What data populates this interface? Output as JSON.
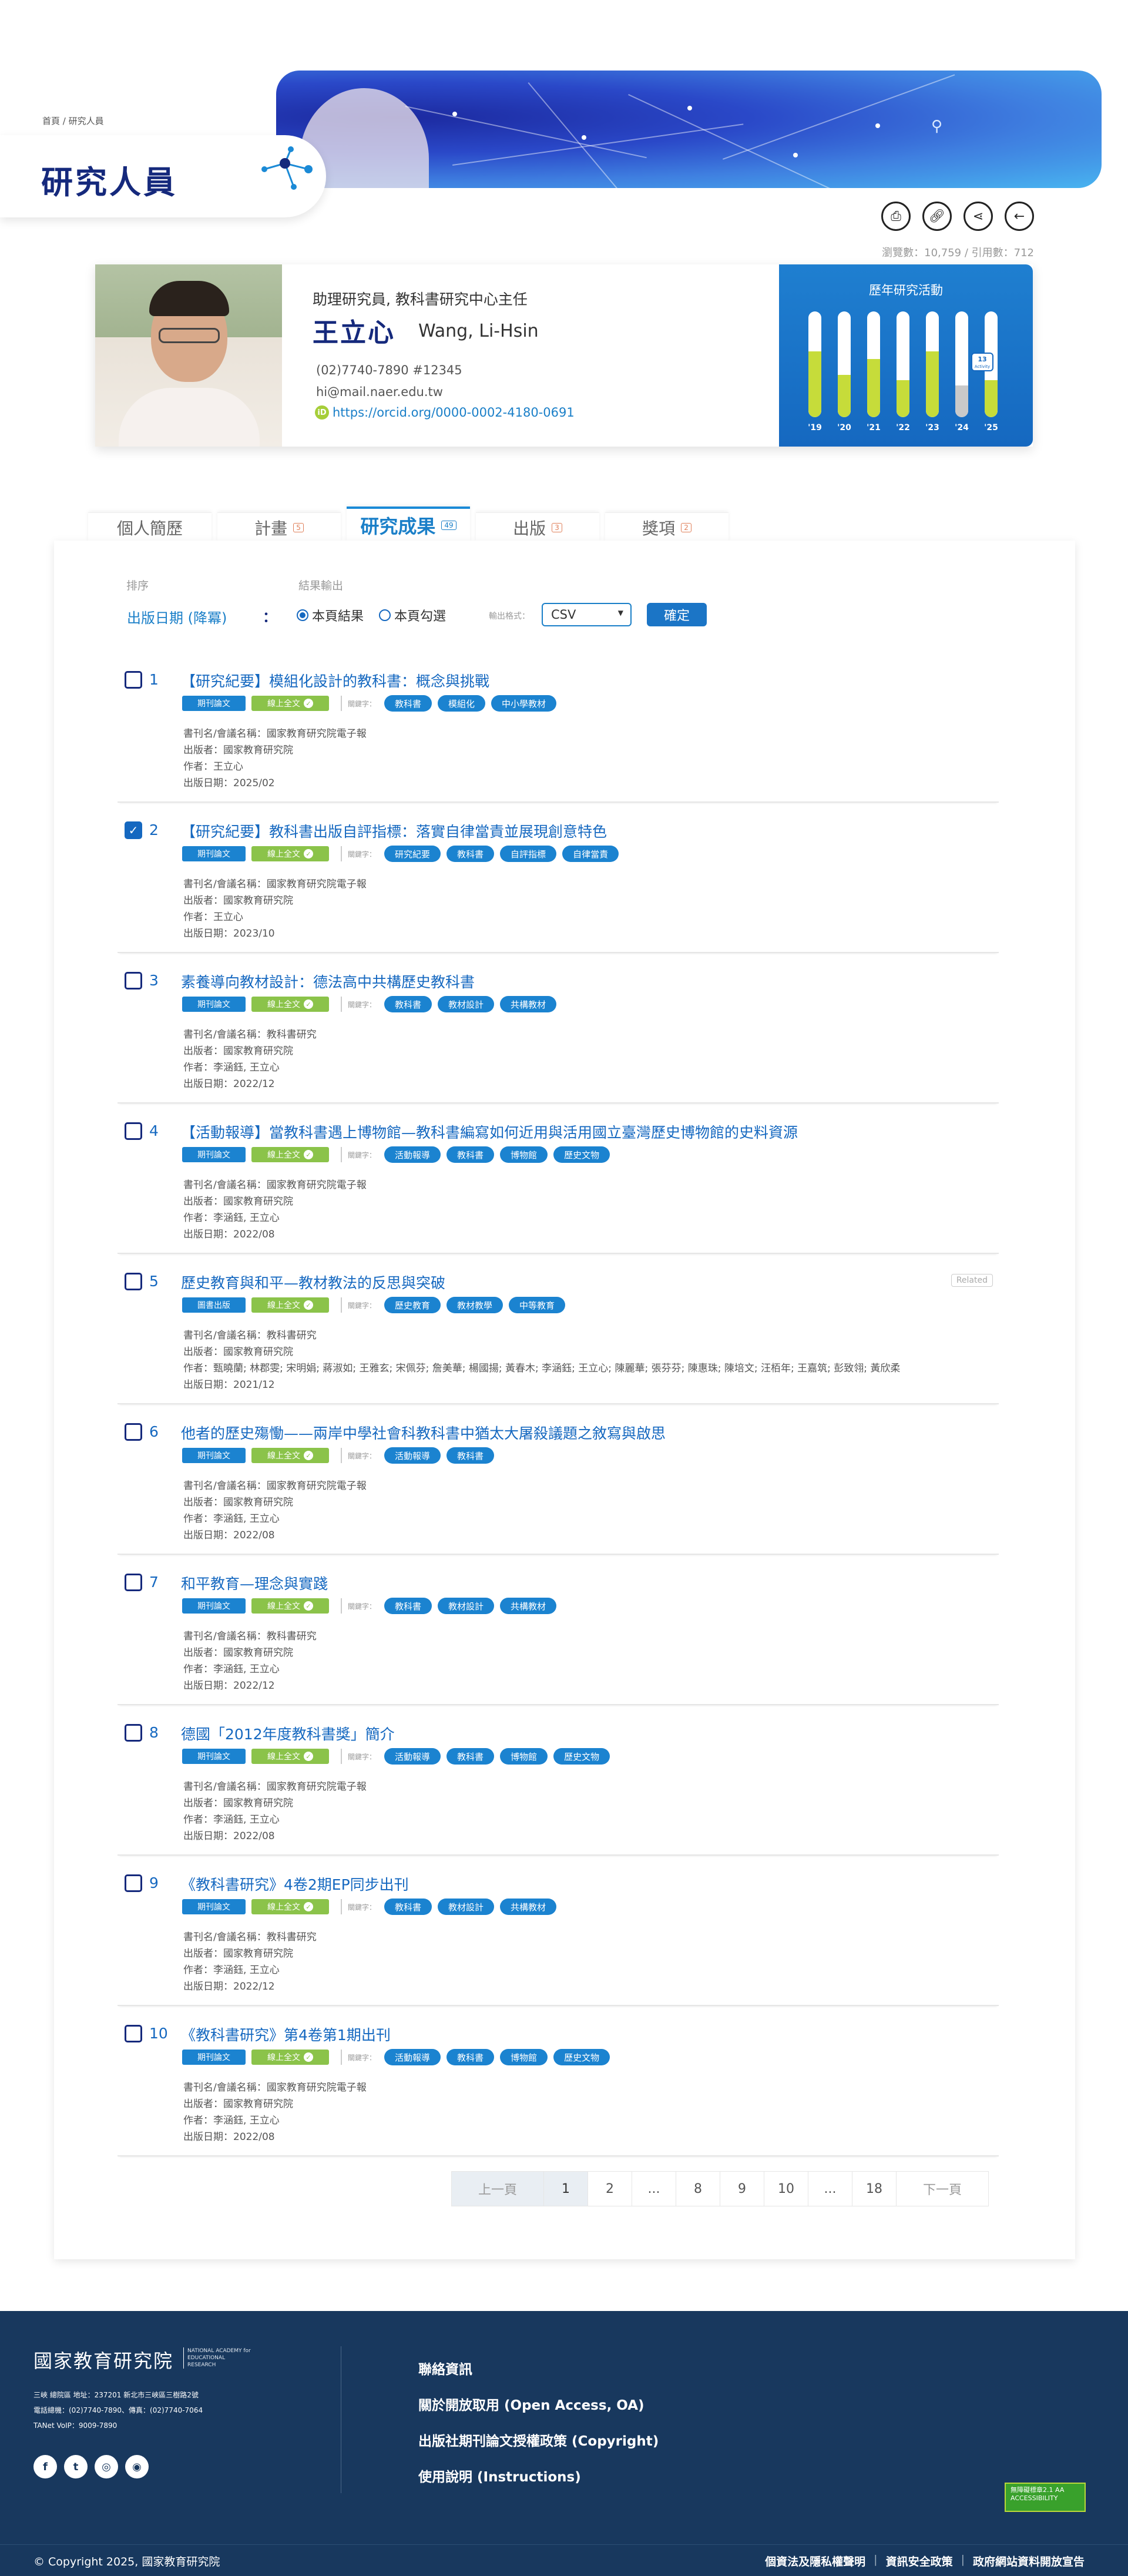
{
  "breadcrumb": "首頁 / 研究人員",
  "page_title": "研究人員",
  "tools": {
    "print_icon": "printer-icon",
    "link_icon": "link-icon",
    "share_icon": "share-icon",
    "back_icon": "back-arrow-icon"
  },
  "stats": "瀏覽數：10,759 / 引用數：712",
  "profile": {
    "job_title": "助理研究員, 教科書研究中心主任",
    "name_zh": "王立心",
    "name_en": "Wang, Li-Hsin",
    "phone": "(02)7740-7890 #12345",
    "email": "hi@mail.naer.edu.tw",
    "orcid_badge": "iD",
    "orcid": "https://orcid.org/0000-0002-4180-0691"
  },
  "activity": {
    "title": "歷年研究活動",
    "years": [
      "'19",
      "'20",
      "'21",
      "'22",
      "'23",
      "'24",
      "'25"
    ],
    "levels": [
      0.62,
      0.4,
      0.55,
      0.35,
      0.62,
      0.3,
      0.35
    ],
    "highlight_index": 5,
    "tooltip_value": "13",
    "tooltip_unit": "Activity"
  },
  "tabs": [
    {
      "label": "個人簡歷",
      "count": ""
    },
    {
      "label": "計畫",
      "count": "5"
    },
    {
      "label": "研究成果",
      "count": "49"
    },
    {
      "label": "出版",
      "count": "3"
    },
    {
      "label": "獎項",
      "count": "2"
    }
  ],
  "filter": {
    "sort_label": "排序",
    "sort_value": "出版日期 (降冪)",
    "colon": "：",
    "export_label": "結果輸出",
    "radio_page": "本頁結果",
    "radio_checked": "本頁勾選",
    "format_label": "輸出格式：",
    "format_value": "CSV",
    "confirm": "確定"
  },
  "labels": {
    "keyword": "關鍵字：",
    "fulltext": "線上全文",
    "journal_prefix": "書刊名/會議名稱：",
    "publisher_prefix": "出版者：",
    "author_prefix": "作者：",
    "date_prefix": "出版日期：",
    "related": "Related"
  },
  "results": [
    {
      "num": "1",
      "checked": false,
      "title": "【研究紀要】模組化設計的教科書：概念與挑戰",
      "type": "期刊論文",
      "keywords": [
        "教科書",
        "模組化",
        "中小學教材"
      ],
      "journal": "國家教育研究院電子報",
      "publisher": "國家教育研究院",
      "author": "王立心",
      "date": "2025/02",
      "related": ""
    },
    {
      "num": "2",
      "checked": true,
      "title": "【研究紀要】教科書出版自評指標：落實自律當責並展現創意特色",
      "type": "期刊論文",
      "keywords": [
        "研究紀要",
        "教科書",
        "自評指標",
        "自律當責"
      ],
      "journal": "國家教育研究院電子報",
      "publisher": "國家教育研究院",
      "author": "王立心",
      "date": "2023/10",
      "related": ""
    },
    {
      "num": "3",
      "checked": false,
      "title": "素養導向教材設計：德法高中共構歷史教科書",
      "type": "期刊論文",
      "keywords": [
        "教科書",
        "教材設計",
        "共構教材"
      ],
      "journal": "教科書研究",
      "publisher": "國家教育研究院",
      "author": "李涵鈺, 王立心",
      "date": "2022/12",
      "related": ""
    },
    {
      "num": "4",
      "checked": false,
      "title": "【活動報導】當教科書遇上博物館—教科書編寫如何近用與活用國立臺灣歷史博物館的史料資源",
      "type": "期刊論文",
      "keywords": [
        "活動報導",
        "教科書",
        "博物館",
        "歷史文物"
      ],
      "journal": "國家教育研究院電子報",
      "publisher": "國家教育研究院",
      "author": "李涵鈺, 王立心",
      "date": "2022/08",
      "related": ""
    },
    {
      "num": "5",
      "checked": false,
      "title": "歷史教育與和平—教材教法的反思與突破",
      "type": "圖書出版",
      "keywords": [
        "歷史教育",
        "教材教學",
        "中等教育"
      ],
      "journal": "教科書研究",
      "publisher": "國家教育研究院",
      "author": "甄曉蘭; 林郡雯; 宋明娟; 蔣淑如; 王雅玄; 宋佩芬; 詹美華; 楊國揚; 黃春木; 李涵鈺; 王立心; 陳麗華; 張芬芬; 陳惠珠; 陳培文; 汪栢年; 王嘉筑; 彭致翎; 黃欣柔",
      "date": "2021/12",
      "related": "Related"
    },
    {
      "num": "6",
      "checked": false,
      "title": "他者的歷史殤慟——兩岸中學社會科教科書中猶太大屠殺議題之敘寫與啟思",
      "type": "期刊論文",
      "keywords": [
        "活動報導",
        "教科書"
      ],
      "journal": "國家教育研究院電子報",
      "publisher": "國家教育研究院",
      "author": "李涵鈺, 王立心",
      "date": "2022/08",
      "related": ""
    },
    {
      "num": "7",
      "checked": false,
      "title": "和平教育—理念與實踐",
      "type": "期刊論文",
      "keywords": [
        "教科書",
        "教材設計",
        "共構教材"
      ],
      "journal": "教科書研究",
      "publisher": "國家教育研究院",
      "author": "李涵鈺, 王立心",
      "date": "2022/12",
      "related": ""
    },
    {
      "num": "8",
      "checked": false,
      "title": "德國「2012年度教科書獎」簡介",
      "type": "期刊論文",
      "keywords": [
        "活動報導",
        "教科書",
        "博物館",
        "歷史文物"
      ],
      "journal": "國家教育研究院電子報",
      "publisher": "國家教育研究院",
      "author": "李涵鈺, 王立心",
      "date": "2022/08",
      "related": ""
    },
    {
      "num": "9",
      "checked": false,
      "title": "《教科書研究》4卷2期EP同步出刊",
      "type": "期刊論文",
      "keywords": [
        "教科書",
        "教材設計",
        "共構教材"
      ],
      "journal": "教科書研究",
      "publisher": "國家教育研究院",
      "author": "李涵鈺, 王立心",
      "date": "2022/12",
      "related": ""
    },
    {
      "num": "10",
      "checked": false,
      "title": "《教科書研究》第4卷第1期出刊",
      "type": "期刊論文",
      "keywords": [
        "活動報導",
        "教科書",
        "博物館",
        "歷史文物"
      ],
      "journal": "國家教育研究院電子報",
      "publisher": "國家教育研究院",
      "author": "李涵鈺, 王立心",
      "date": "2022/08",
      "related": ""
    }
  ],
  "pager": {
    "prev": "上一頁",
    "pages": [
      "1",
      "2",
      "...",
      "8",
      "9",
      "10",
      "...",
      "18"
    ],
    "current": "1",
    "next": "下一頁"
  },
  "footer": {
    "logo": "國家教育研究院",
    "logo_en": "NATIONAL ACADEMY for EDUCATIONAL RESEARCH",
    "address": "三峽 總院區 地址：237201 新北市三峽區三樹路2號",
    "phone": "電話總機：(02)7740-7890、傳真：(02)7740-7064",
    "voip": "TANet VoIP：9009-7890",
    "social": [
      "facebook-icon",
      "twitter-icon",
      "instagram-icon",
      "podcast-icon"
    ],
    "links": [
      "聯絡資訊",
      "關於開放取用 (Open Access, OA)",
      "出版社期刊論文授權政策 (Copyright)",
      "使用說明 (Instructions)"
    ],
    "a11y_badge": "無障礙標章2.1 AA ACCESSIBILITY",
    "copyright": "© Copyright 2025, 國家教育研究院",
    "bottom_links": [
      "個資法及隱私權聲明",
      "資訊安全政策",
      "政府網站資料開放宣告"
    ]
  }
}
